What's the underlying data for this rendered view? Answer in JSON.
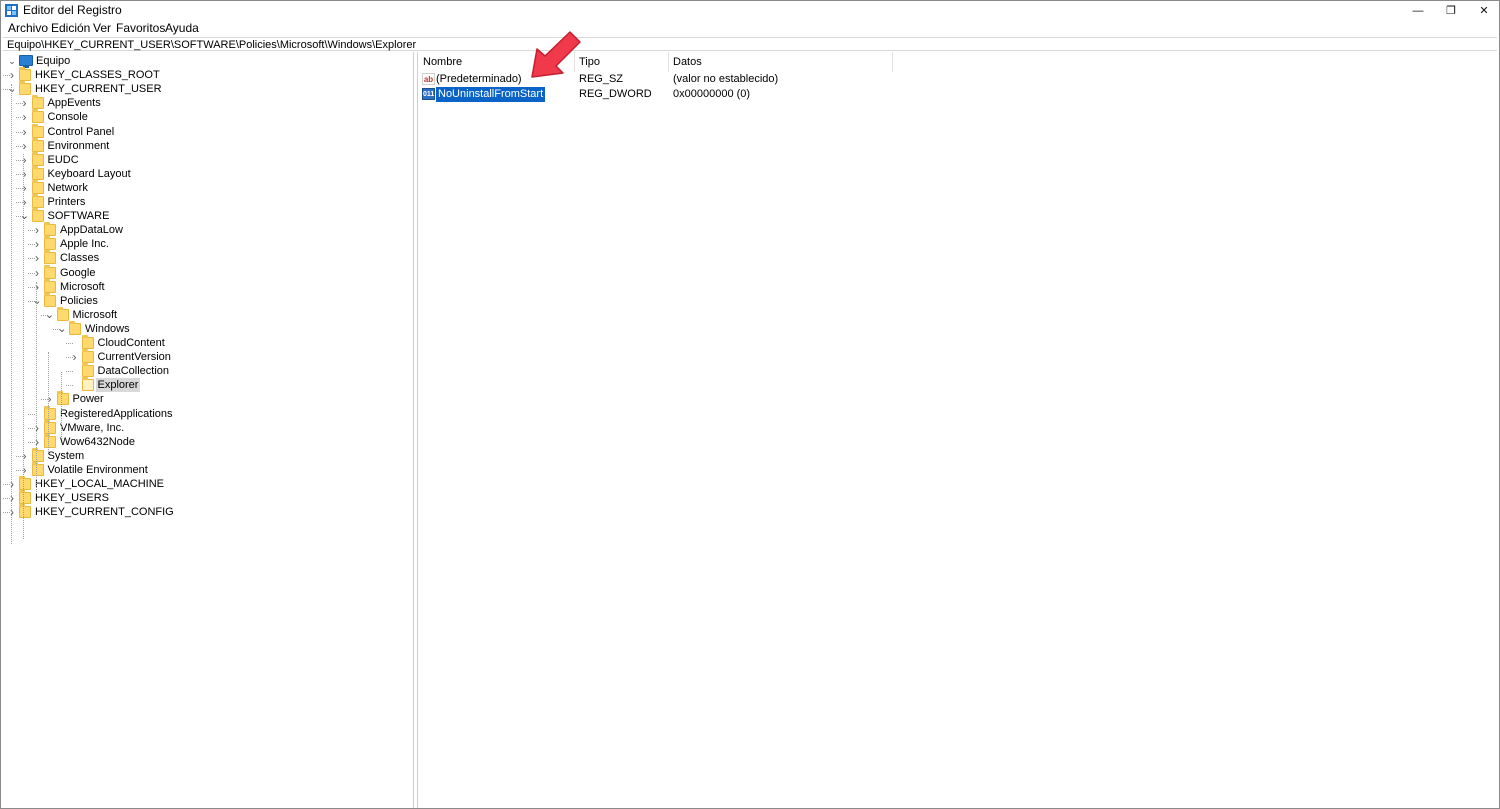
{
  "window": {
    "title": "Editor del Registro",
    "controls": {
      "minimize": "—",
      "maximize": "❐",
      "close": "✕"
    }
  },
  "menu": [
    "Archivo",
    "Edición",
    "Ver",
    "Favoritos",
    "Ayuda"
  ],
  "address": "Equipo\\HKEY_CURRENT_USER\\SOFTWARE\\Policies\\Microsoft\\Windows\\Explorer",
  "tree": {
    "root": "Equipo",
    "items": [
      {
        "label": "HKEY_CLASSES_ROOT",
        "depth": 1,
        "expander": "closed"
      },
      {
        "label": "HKEY_CURRENT_USER",
        "depth": 1,
        "expander": "open"
      },
      {
        "label": "AppEvents",
        "depth": 2,
        "expander": "closed"
      },
      {
        "label": "Console",
        "depth": 2,
        "expander": "closed"
      },
      {
        "label": "Control Panel",
        "depth": 2,
        "expander": "closed"
      },
      {
        "label": "Environment",
        "depth": 2,
        "expander": "closed"
      },
      {
        "label": "EUDC",
        "depth": 2,
        "expander": "closed"
      },
      {
        "label": "Keyboard Layout",
        "depth": 2,
        "expander": "closed"
      },
      {
        "label": "Network",
        "depth": 2,
        "expander": "closed"
      },
      {
        "label": "Printers",
        "depth": 2,
        "expander": "closed"
      },
      {
        "label": "SOFTWARE",
        "depth": 2,
        "expander": "open"
      },
      {
        "label": "AppDataLow",
        "depth": 3,
        "expander": "closed"
      },
      {
        "label": "Apple Inc.",
        "depth": 3,
        "expander": "closed"
      },
      {
        "label": "Classes",
        "depth": 3,
        "expander": "closed"
      },
      {
        "label": "Google",
        "depth": 3,
        "expander": "closed"
      },
      {
        "label": "Microsoft",
        "depth": 3,
        "expander": "closed"
      },
      {
        "label": "Policies",
        "depth": 3,
        "expander": "open"
      },
      {
        "label": "Microsoft",
        "depth": 4,
        "expander": "open"
      },
      {
        "label": "Windows",
        "depth": 5,
        "expander": "open"
      },
      {
        "label": "CloudContent",
        "depth": 6,
        "expander": "none"
      },
      {
        "label": "CurrentVersion",
        "depth": 6,
        "expander": "closed"
      },
      {
        "label": "DataCollection",
        "depth": 6,
        "expander": "none"
      },
      {
        "label": "Explorer",
        "depth": 6,
        "expander": "none",
        "selected": true
      },
      {
        "label": "Power",
        "depth": 4,
        "expander": "closed"
      },
      {
        "label": "RegisteredApplications",
        "depth": 3,
        "expander": "none"
      },
      {
        "label": "VMware, Inc.",
        "depth": 3,
        "expander": "closed"
      },
      {
        "label": "Wow6432Node",
        "depth": 3,
        "expander": "closed"
      },
      {
        "label": "System",
        "depth": 2,
        "expander": "closed"
      },
      {
        "label": "Volatile Environment",
        "depth": 2,
        "expander": "closed"
      },
      {
        "label": "HKEY_LOCAL_MACHINE",
        "depth": 1,
        "expander": "closed"
      },
      {
        "label": "HKEY_USERS",
        "depth": 1,
        "expander": "closed"
      },
      {
        "label": "HKEY_CURRENT_CONFIG",
        "depth": 1,
        "expander": "closed"
      }
    ]
  },
  "list": {
    "columns": [
      "Nombre",
      "Tipo",
      "Datos"
    ],
    "rows": [
      {
        "icon": "string-value-icon",
        "icon_text": "ab",
        "name": "(Predeterminado)",
        "type": "REG_SZ",
        "data": "(valor no establecido)",
        "selected": false
      },
      {
        "icon": "binary-value-icon",
        "icon_text": "011",
        "name": "NoUninstallFromStart",
        "type": "REG_DWORD",
        "data": "0x00000000 (0)",
        "selected": true
      }
    ]
  },
  "colors": {
    "selection": "#0a64c8",
    "tree_selection": "#d9d9d9",
    "folder": "#ffd86e",
    "annotation_arrow": "#f0394a"
  }
}
